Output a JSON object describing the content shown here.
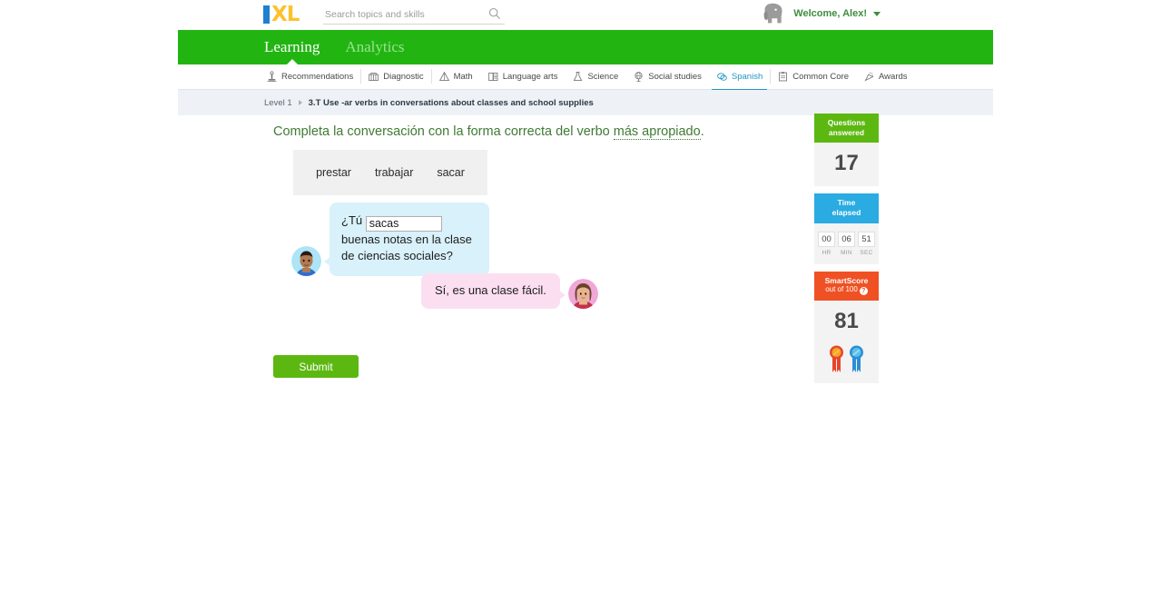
{
  "header": {
    "logo_alt": "IXL",
    "logo_i": "I",
    "logo_xl": "XL",
    "search": {
      "placeholder": "Search topics and skills",
      "value": ""
    },
    "user": {
      "greeting": "Welcome, Alex!"
    }
  },
  "green_nav": {
    "tabs": [
      {
        "label": "Learning",
        "active": true
      },
      {
        "label": "Analytics",
        "active": false
      }
    ]
  },
  "subject_nav": {
    "items": [
      {
        "label": "Recommendations",
        "icon": "recommendations-icon",
        "active": false
      },
      {
        "label": "Diagnostic",
        "icon": "diagnostic-icon",
        "active": false
      },
      {
        "label": "Math",
        "icon": "math-icon",
        "active": false
      },
      {
        "label": "Language arts",
        "icon": "language-arts-icon",
        "active": false
      },
      {
        "label": "Science",
        "icon": "science-icon",
        "active": false
      },
      {
        "label": "Social studies",
        "icon": "social-studies-icon",
        "active": false
      },
      {
        "label": "Spanish",
        "icon": "spanish-icon",
        "active": true
      },
      {
        "label": "Common Core",
        "icon": "common-core-icon",
        "active": false
      },
      {
        "label": "Awards",
        "icon": "awards-icon",
        "active": false
      }
    ]
  },
  "breadcrumb": {
    "level": "Level 1",
    "skill": "3.T Use -ar verbs in conversations about classes and school supplies"
  },
  "question": {
    "prompt_plain": "Completa la conversación con la forma correcta del verbo ",
    "prompt_emphasis": "más apropiado",
    "prompt_end": ".",
    "word_bank": [
      "prestar",
      "trabajar",
      "sacar"
    ],
    "dialogue": [
      {
        "speaker": "boy-avatar",
        "side": "left",
        "text_before": "¿Tú ",
        "input_value": "sacas",
        "text_after": " buenas notas en la clase de ciencias sociales?"
      },
      {
        "speaker": "girl-avatar",
        "side": "right",
        "text": "Sí, es una clase fácil."
      }
    ],
    "submit_label": "Submit"
  },
  "sidebar": {
    "questions": {
      "title_line1": "Questions",
      "title_line2": "answered",
      "value": "17",
      "color": "#5cb811"
    },
    "time": {
      "title_line1": "Time",
      "title_line2": "elapsed",
      "color": "#2aabe2",
      "units": [
        {
          "value": "00",
          "label": "HR"
        },
        {
          "value": "06",
          "label": "MIN"
        },
        {
          "value": "51",
          "label": "SEC"
        }
      ]
    },
    "smartscore": {
      "title_line1": "SmartScore",
      "title_line2": "out of 100",
      "help": "?",
      "value": "81",
      "color": "#ef5124",
      "ribbons": [
        "orange-ribbon",
        "blue-ribbon"
      ]
    }
  }
}
